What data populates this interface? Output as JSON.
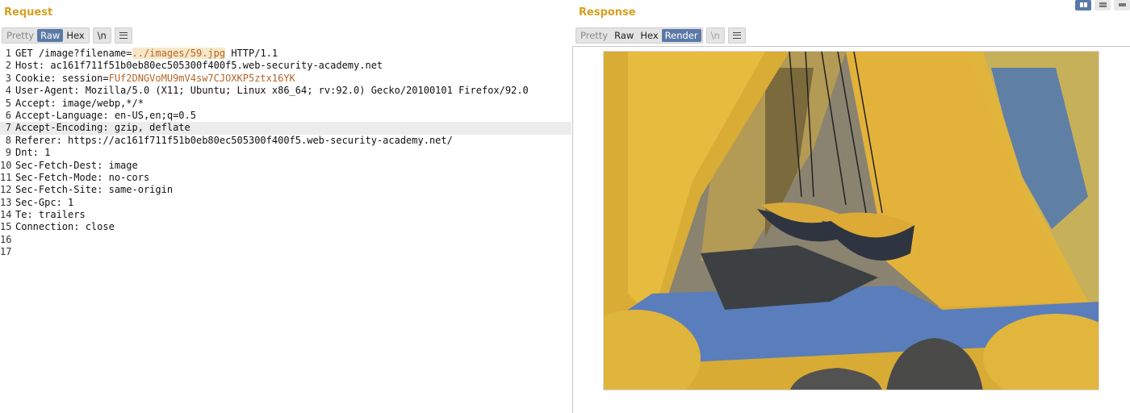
{
  "request": {
    "title": "Request",
    "toolbar": {
      "pretty": "Pretty",
      "raw": "Raw",
      "hex": "Hex",
      "newline": "\\n"
    },
    "lines": [
      {
        "num": "1",
        "parts": [
          {
            "t": "GET /image?filename="
          },
          {
            "t": "../images/59.jpg",
            "c": "hv sel"
          },
          {
            "t": " HTTP/1.1"
          }
        ]
      },
      {
        "num": "2",
        "parts": [
          {
            "t": "Host: ac161f711f51b0eb80ec505300f400f5.web-security-academy.net"
          }
        ]
      },
      {
        "num": "3",
        "parts": [
          {
            "t": "Cookie: session="
          },
          {
            "t": "FUf2DNGVoMU9mV4sw7CJOXKP5ztx16YK",
            "c": "hv"
          }
        ]
      },
      {
        "num": "4",
        "parts": [
          {
            "t": "User-Agent: Mozilla/5.0 (X11; Ubuntu; Linux x86_64; rv:92.0) Gecko/20100101 Firefox/92.0"
          }
        ]
      },
      {
        "num": "5",
        "parts": [
          {
            "t": "Accept: image/webp,*/*"
          }
        ]
      },
      {
        "num": "6",
        "parts": [
          {
            "t": "Accept-Language: en-US,en;q=0.5"
          }
        ]
      },
      {
        "num": "7",
        "parts": [
          {
            "t": "Accept-Encoding: gzip, deflate"
          }
        ],
        "hl": true
      },
      {
        "num": "8",
        "parts": [
          {
            "t": "Referer: https://ac161f711f51b0eb80ec505300f400f5.web-security-academy.net/"
          }
        ]
      },
      {
        "num": "9",
        "parts": [
          {
            "t": "Dnt: 1"
          }
        ]
      },
      {
        "num": "10",
        "parts": [
          {
            "t": "Sec-Fetch-Dest: image"
          }
        ]
      },
      {
        "num": "11",
        "parts": [
          {
            "t": "Sec-Fetch-Mode: no-cors"
          }
        ]
      },
      {
        "num": "12",
        "parts": [
          {
            "t": "Sec-Fetch-Site: same-origin"
          }
        ]
      },
      {
        "num": "13",
        "parts": [
          {
            "t": "Sec-Gpc: 1"
          }
        ]
      },
      {
        "num": "14",
        "parts": [
          {
            "t": "Te: trailers"
          }
        ]
      },
      {
        "num": "15",
        "parts": [
          {
            "t": "Connection: close"
          }
        ]
      },
      {
        "num": "16",
        "parts": []
      },
      {
        "num": "17",
        "parts": []
      }
    ]
  },
  "response": {
    "title": "Response",
    "toolbar": {
      "pretty": "Pretty",
      "raw": "Raw",
      "hex": "Hex",
      "render": "Render",
      "newline": "\\n"
    },
    "active_tab": "Render"
  },
  "colors": {
    "accent": "#5b79a7",
    "title": "#d4a020",
    "highlight_value": "#b5662a"
  },
  "icons": [
    "menu-icon",
    "split-horizontal-icon",
    "split-vertical-icon",
    "single-pane-icon",
    "splitter-handle-icon"
  ]
}
